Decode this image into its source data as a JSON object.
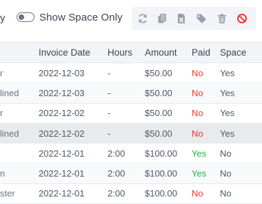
{
  "filters": {
    "left_fragment": "y",
    "show_space_only_label": "Show Space Only"
  },
  "toolbar": {
    "icons": [
      "refresh-icon",
      "copy-icon",
      "excel-export-icon",
      "tag-icon",
      "trash-icon",
      "block-icon"
    ],
    "icon_color": "#9aa0aa",
    "block_color": "#e53935"
  },
  "table": {
    "headers": [
      "",
      "Invoice Date",
      "Hours",
      "Amount",
      "Paid",
      "Space"
    ],
    "rows": [
      {
        "c0": "r",
        "date": "2022-12-03",
        "hours": "-",
        "amount": "$50.00",
        "paid": "No",
        "space": "Yes"
      },
      {
        "c0": "lined",
        "date": "2022-12-03",
        "hours": "-",
        "amount": "$50.00",
        "paid": "No",
        "space": "Yes"
      },
      {
        "c0": "r",
        "date": "2022-12-02",
        "hours": "-",
        "amount": "$50.00",
        "paid": "No",
        "space": "Yes"
      },
      {
        "c0": "lined",
        "date": "2022-12-02",
        "hours": "-",
        "amount": "$50.00",
        "paid": "No",
        "space": "Yes"
      },
      {
        "c0": "",
        "date": "2022-12-01",
        "hours": "2:00",
        "amount": "$100.00",
        "paid": "Yes",
        "space": "No"
      },
      {
        "c0": "n",
        "date": "2022-12-01",
        "hours": "2:00",
        "amount": "$100.00",
        "paid": "Yes",
        "space": "No"
      },
      {
        "c0": "ster",
        "date": "2022-12-01",
        "hours": "2:00",
        "amount": "$100.00",
        "paid": "No",
        "space": "No"
      }
    ]
  }
}
